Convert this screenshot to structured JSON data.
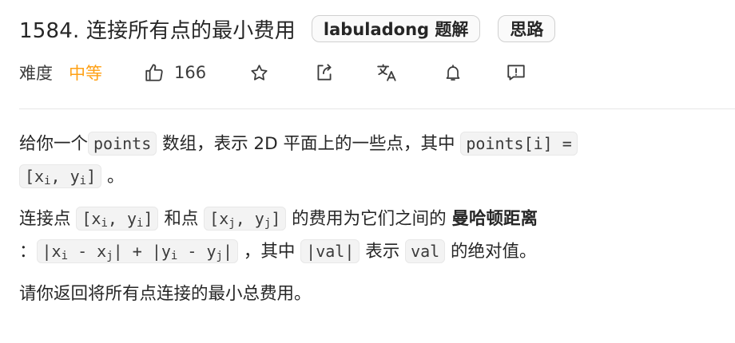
{
  "problem": {
    "title": "1584. 连接所有点的最小费用",
    "tags": [
      "labuladong 题解",
      "思路"
    ]
  },
  "meta": {
    "difficulty_label": "难度",
    "difficulty": "中等",
    "like_count": "166",
    "icons": [
      "thumbs-up-icon",
      "star-icon",
      "share-icon",
      "translate-icon",
      "bell-icon",
      "feedback-icon"
    ],
    "difficulty_color": "#ffa116"
  },
  "description": {
    "p1": {
      "t1": "给你一个",
      "c1": "points",
      "t2": " 数组，表示 2D 平面上的一些点，其中 ",
      "c2": "points[i] =",
      "c3a": "[x",
      "c3s1": "i",
      "c3b": ", y",
      "c3s2": "i",
      "c3c": "]",
      "t3": " 。"
    },
    "p2": {
      "t1": "连接点 ",
      "c1a": "[x",
      "c1s1": "i",
      "c1b": ", y",
      "c1s2": "i",
      "c1c": "]",
      "t2": " 和点 ",
      "c2a": "[x",
      "c2s1": "j",
      "c2b": ", y",
      "c2s2": "j",
      "c2c": "]",
      "t3": " 的费用为它们之间的 ",
      "bold": "曼哈顿距离",
      "t4": " ：",
      "c3a": "|x",
      "c3s1": "i",
      "c3b": " - x",
      "c3s2": "j",
      "c3c": "| + |y",
      "c3s3": "i",
      "c3d": " - y",
      "c3s4": "j",
      "c3e": "|",
      "t5": " ，其中 ",
      "c4": "|val|",
      "t6": " 表示 ",
      "c5": "val",
      "t7": " 的绝对值。"
    },
    "p3": "请你返回将所有点连接的最小总费用。"
  }
}
